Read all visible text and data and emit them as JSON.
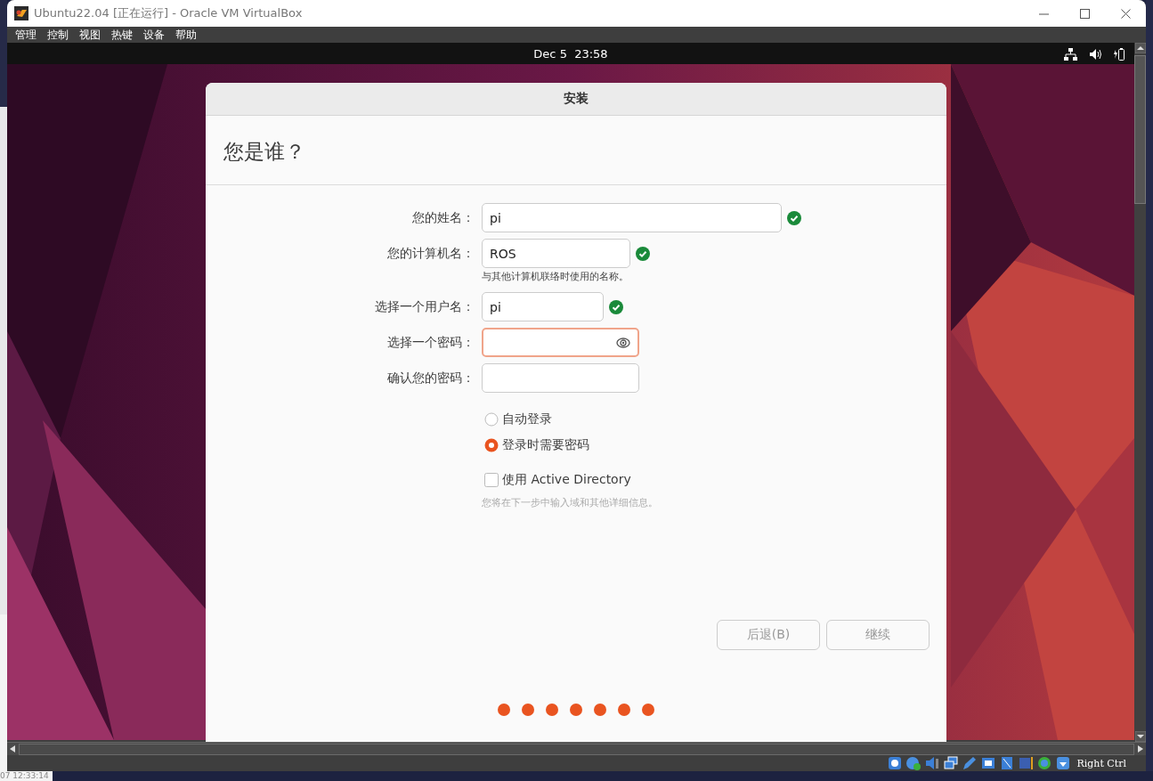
{
  "window": {
    "title": "Ubuntu22.04 [正在运行] - Oracle VM VirtualBox"
  },
  "menu": [
    {
      "label": "管理"
    },
    {
      "label": "控制"
    },
    {
      "label": "视图"
    },
    {
      "label": "热键"
    },
    {
      "label": "设备"
    },
    {
      "label": "帮助"
    }
  ],
  "guest_top_bar": {
    "clock": "Dec 5  23:58"
  },
  "installer": {
    "title": "安装",
    "heading": "您是谁？",
    "fields": [
      {
        "label": "您的姓名：",
        "value": "pi",
        "valid": true,
        "focused": false,
        "show_toggle": false
      },
      {
        "label": "您的计算机名：",
        "value": "ROS",
        "valid": true,
        "focused": false,
        "show_toggle": false,
        "hint": "与其他计算机联络时使用的名称。"
      },
      {
        "label": "选择一个用户名：",
        "value": "pi",
        "valid": true,
        "focused": false,
        "show_toggle": false
      },
      {
        "label": "选择一个密码：",
        "valid": false,
        "focused": true,
        "show_toggle": true
      },
      {
        "label": "确认您的密码：",
        "valid": false,
        "focused": false,
        "show_toggle": false
      }
    ],
    "radios": [
      {
        "label": "自动登录",
        "selected": false
      },
      {
        "label": "登录时需要密码",
        "selected": true
      }
    ],
    "checkbox": {
      "label": "使用 Active Directory",
      "checked": false
    },
    "checkbox_hint": "您将在下一步中输入域和其他详细信息。",
    "buttons": [
      {
        "label": "后退(B)",
        "disabled": true
      },
      {
        "label": "继续",
        "disabled": true
      }
    ],
    "progress_steps": [
      {
        "done": true
      },
      {
        "done": true
      },
      {
        "done": true
      },
      {
        "done": true
      },
      {
        "done": true
      },
      {
        "done": true
      },
      {
        "done": true
      }
    ]
  },
  "status_bar": {
    "host_key": "Right Ctrl"
  },
  "desktop": {
    "timestamp": "07 12:33:14"
  }
}
